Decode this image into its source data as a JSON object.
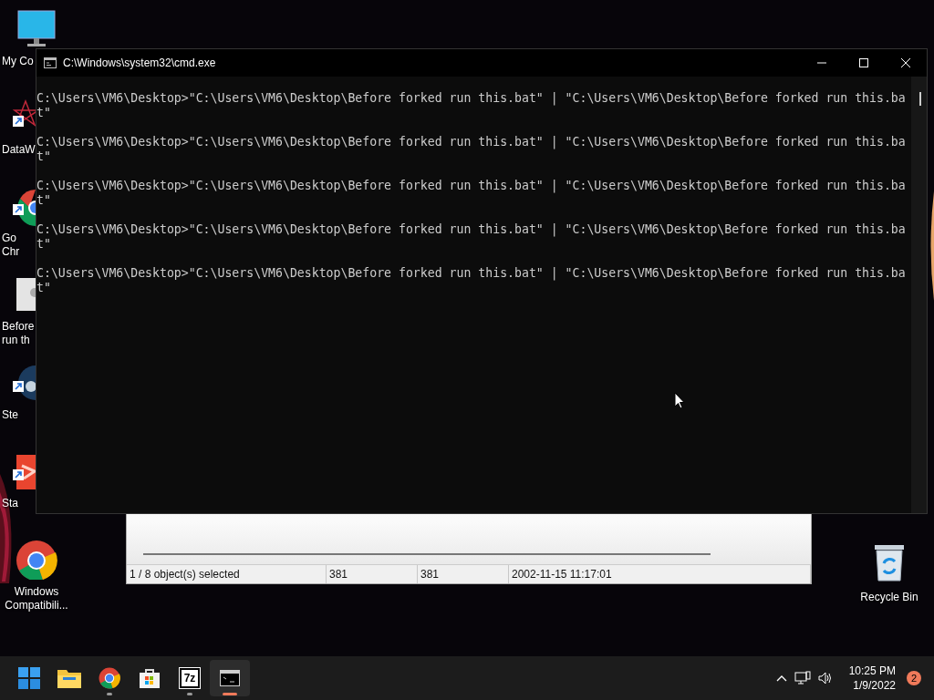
{
  "desktop_icons": [
    {
      "kind": "monitor",
      "shortcut": false,
      "label_lines": [
        "My Co"
      ]
    },
    {
      "kind": "web",
      "shortcut": true,
      "label_lines": [
        "DataW"
      ]
    },
    {
      "kind": "chrome",
      "shortcut": true,
      "label_lines": [
        "Go",
        "Chr"
      ]
    },
    {
      "kind": "file",
      "shortcut": false,
      "label_lines": [
        "Before",
        "run th"
      ]
    },
    {
      "kind": "steam",
      "shortcut": true,
      "label_lines": [
        "Ste"
      ]
    },
    {
      "kind": "stadia",
      "shortcut": true,
      "label_lines": [
        "Sta"
      ]
    },
    {
      "kind": "chrome_full",
      "shortcut": false,
      "label_lines": [
        "Windows",
        "Compatibili..."
      ]
    }
  ],
  "recycle_bin": {
    "label": "Recycle Bin"
  },
  "file_manager": {
    "status_bar": [
      "1 / 8 object(s) selected",
      "381",
      "381",
      "2002-11-15 11:17:01"
    ]
  },
  "console_window": {
    "title": "C:\\Windows\\system32\\cmd.exe",
    "entries": [
      {
        "line": "C:\\Users\\VM6\\Desktop>\"C:\\Users\\VM6\\Desktop\\Before forked run this.bat\" | \"C:\\Users\\VM6\\Desktop\\Before forked run this.ba",
        "wrap": "t\""
      },
      {
        "line": "C:\\Users\\VM6\\Desktop>\"C:\\Users\\VM6\\Desktop\\Before forked run this.bat\" | \"C:\\Users\\VM6\\Desktop\\Before forked run this.ba",
        "wrap": "t\""
      },
      {
        "line": "C:\\Users\\VM6\\Desktop>\"C:\\Users\\VM6\\Desktop\\Before forked run this.bat\" | \"C:\\Users\\VM6\\Desktop\\Before forked run this.ba",
        "wrap": "t\""
      },
      {
        "line": "C:\\Users\\VM6\\Desktop>\"C:\\Users\\VM6\\Desktop\\Before forked run this.bat\" | \"C:\\Users\\VM6\\Desktop\\Before forked run this.ba",
        "wrap": "t\""
      },
      {
        "line": "C:\\Users\\VM6\\Desktop>\"C:\\Users\\VM6\\Desktop\\Before forked run this.bat\" | \"C:\\Users\\VM6\\Desktop\\Before forked run this.ba",
        "wrap": "t\""
      }
    ]
  },
  "taskbar": {
    "apps": [
      {
        "kind": "start",
        "running": false,
        "selected": false
      },
      {
        "kind": "explorer",
        "running": false,
        "selected": false
      },
      {
        "kind": "chrome",
        "running": true,
        "selected": false
      },
      {
        "kind": "store",
        "running": false,
        "selected": false
      },
      {
        "kind": "sevenzip",
        "label": "7z",
        "running": true,
        "selected": false
      },
      {
        "kind": "terminal",
        "running": true,
        "selected": true
      }
    ],
    "time": "10:25 PM",
    "date": "1/9/2022",
    "notifications": "2"
  }
}
